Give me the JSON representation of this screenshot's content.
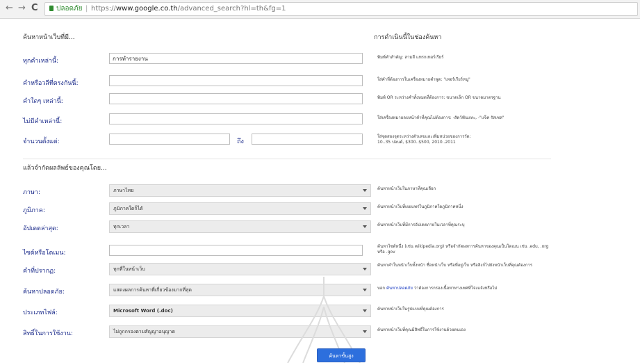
{
  "browser": {
    "back": "←",
    "forward": "→",
    "reload": "C",
    "secure_label": "ปลอดภัย",
    "separator": "|",
    "url_scheme": "https://",
    "url_host": "www.google.co.th",
    "url_path": "/advanced_search?hl=th&fg=1"
  },
  "sections": {
    "find_title": "ค้นหาหน้าเว็บที่มี...",
    "help_title": "การดำเนินนี้ในช่องค้นหา",
    "narrow_title": "แล้วจำกัดผลลัพธ์ของคุณโดย..."
  },
  "find_rows": [
    {
      "label": "ทุกคำเหล่านี้:",
      "value": "การทำรายงาน",
      "help": "พิมพ์คำสำคัญ: สามสี แทรกเทอร์เรียร์"
    },
    {
      "label": "คำหรือวลีที่ตรงกันนี้:",
      "value": "",
      "help": "ใส่คำที่ต้องการในเครื่องหมายคำพูด: \"เทอร์เรียร์หนู\""
    },
    {
      "label": "คำใดๆ เหล่านี้:",
      "value": "",
      "help": "พิมพ์ OR ระหว่างคำทั้งหมดที่ต้องการ: ขนาดเล็ก OR ขนาดมาตรฐาน"
    },
    {
      "label": "ไม่มีคำเหล่านี้:",
      "value": "",
      "help": "ใส่เครื่องหมายลบหน้าคำที่คุณไม่ต้องการ: -สัตว์ฟันแทะ, -\"แจ็ค รัสเซล\""
    }
  ],
  "number_range": {
    "label": "จำนวนตั้งแต่:",
    "from_value": "",
    "to_label": "ถึง",
    "to_value": "",
    "help_line1": "ใส่จุดสองจุดระหว่างตัวเลขและเพิ่มหน่วยของการวัด:",
    "help_line2": "10..35 ปอนด์, $300..$500, 2010..2011"
  },
  "narrow_rows": [
    {
      "label": "ภาษา:",
      "type": "select",
      "value": "ภาษาไทย",
      "help": "ค้นหาหน้าเว็บในภาษาที่คุณเลือก"
    },
    {
      "label": "ภูมิภาค:",
      "type": "select",
      "value": "ภูมิภาคใดก็ได้",
      "help": "ค้นหาหน้าเว็บที่เผยแพร่ในภูมิภาคใดภูมิภาคหนึ่ง"
    },
    {
      "label": "อัปเดตล่าสุด:",
      "type": "select",
      "value": "ทุกเวลา",
      "help": "ค้นหาหน้าเว็บที่มีการอัปเดตภายในเวลาที่คุณระบุ"
    },
    {
      "label": "ไซต์หรือโดเมน:",
      "type": "input",
      "value": "",
      "help": "ค้นหาไซต์หนึ่ง (เช่น wikipedia.org) หรือจำกัดผลการค้นหาของคุณเป็นโดเมน เช่น .edu, .org หรือ .gov"
    },
    {
      "label": "คำที่ปรากฏ:",
      "type": "select",
      "value": "ทุกที่ในหน้าเว็บ",
      "help": "ค้นหาคำในหน้าเว็บทั้งหน้า ชื่อหน้าเว็บ หรือที่อยู่เว็บ หรือลิงก์ไปยังหน้าเว็บที่คุณต้องการ"
    },
    {
      "label": "ค้นหาปลอดภัย:",
      "type": "select",
      "value": "แสดงผลการค้นหาที่เกี่ยวข้องมากที่สุด",
      "help_link": "ค้นหาปลอดภัย",
      "help_pre": "บอก ",
      "help": " ว่าต้องการกรองเนื้อหาทางเพศที่โจ่งแจ้งหรือไม่"
    },
    {
      "label": "ประเภทไฟล์:",
      "type": "select",
      "value": "Microsoft Word (.doc)",
      "help": "ค้นหาหน้าเว็บในรูปแบบที่คุณต้องการ"
    },
    {
      "label": "สิทธิ์ในการใช้งาน:",
      "type": "select",
      "value": "ไม่ถูกกรองตามสัญญาอนุญาต",
      "help": "ค้นหาหน้าเว็บที่คุณมีสิทธิ์ในการใช้งานด้วยตนเอง"
    }
  ],
  "submit_label": "ค้นหาขั้นสูง",
  "colors": {
    "label": "#1a2a8a",
    "button": "#2d6fdd",
    "secure": "#2e8b2e"
  }
}
